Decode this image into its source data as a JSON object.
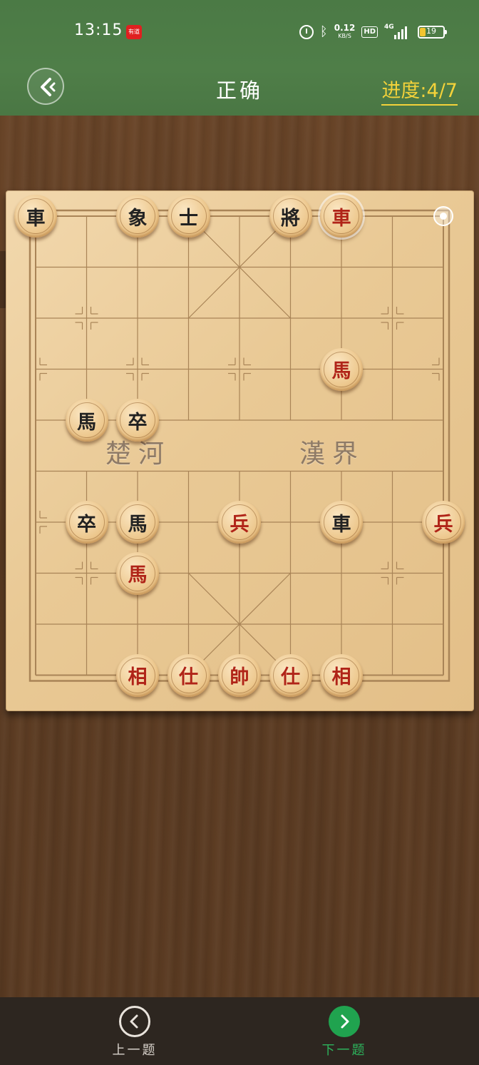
{
  "status_bar": {
    "time": "13:15",
    "app_badge": "有道",
    "net_speed": "0.12",
    "net_unit": "KB/S",
    "hd": "HD",
    "network_gen": "4G",
    "battery": "19"
  },
  "header": {
    "title": "正确",
    "progress_label": "进度:4/7"
  },
  "board": {
    "river_left": "楚河",
    "river_right": "漢界",
    "pieces": [
      {
        "char": "車",
        "color": "black",
        "col": 0,
        "row": 0
      },
      {
        "char": "象",
        "color": "black",
        "col": 2,
        "row": 0
      },
      {
        "char": "士",
        "color": "black",
        "col": 3,
        "row": 0
      },
      {
        "char": "將",
        "color": "black",
        "col": 5,
        "row": 0
      },
      {
        "char": "車",
        "color": "red",
        "col": 6,
        "row": 0,
        "selected": true
      },
      {
        "char": "馬",
        "color": "red",
        "col": 6,
        "row": 3
      },
      {
        "char": "馬",
        "color": "black",
        "col": 1,
        "row": 4
      },
      {
        "char": "卒",
        "color": "black",
        "col": 2,
        "row": 4
      },
      {
        "char": "卒",
        "color": "black",
        "col": 1,
        "row": 6
      },
      {
        "char": "馬",
        "color": "black",
        "col": 2,
        "row": 6
      },
      {
        "char": "兵",
        "color": "red",
        "col": 4,
        "row": 6
      },
      {
        "char": "車",
        "color": "black",
        "col": 6,
        "row": 6
      },
      {
        "char": "兵",
        "color": "red",
        "col": 8,
        "row": 6
      },
      {
        "char": "馬",
        "color": "red",
        "col": 2,
        "row": 7
      },
      {
        "char": "相",
        "color": "red",
        "col": 2,
        "row": 9
      },
      {
        "char": "仕",
        "color": "red",
        "col": 3,
        "row": 9
      },
      {
        "char": "帥",
        "color": "red",
        "col": 4,
        "row": 9
      },
      {
        "char": "仕",
        "color": "red",
        "col": 5,
        "row": 9
      },
      {
        "char": "相",
        "color": "red",
        "col": 6,
        "row": 9
      }
    ],
    "move_marker": {
      "col": 8,
      "row": 0
    }
  },
  "bottom_nav": {
    "prev_label": "上一题",
    "next_label": "下一题"
  },
  "colors": {
    "header_green": "#4e7d47",
    "progress_yellow": "#f3d23a",
    "next_green": "#20a34f",
    "red_piece_text": "#b02418"
  }
}
